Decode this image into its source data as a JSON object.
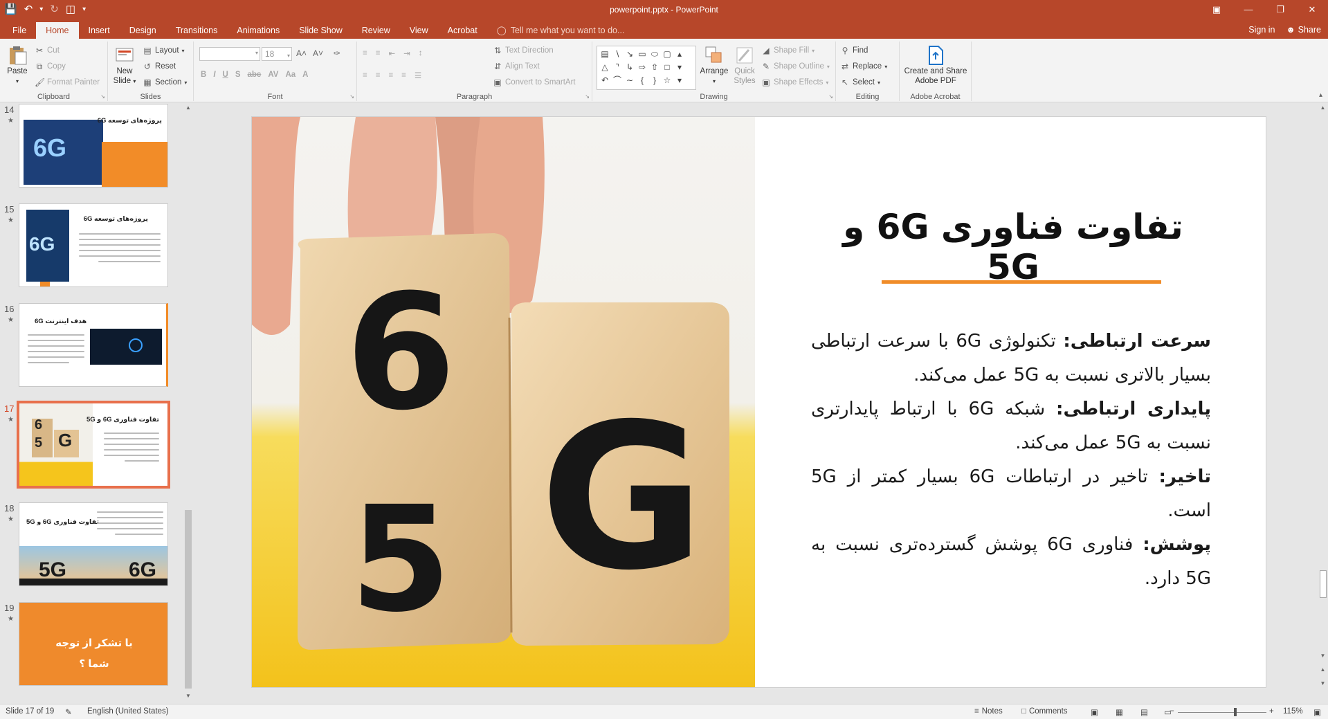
{
  "window": {
    "title": "powerpoint.pptx - PowerPoint",
    "accent": "#b7472a"
  },
  "qat": {
    "save_icon": "save-icon",
    "undo_icon": "undo-icon",
    "redo_icon": "redo-icon",
    "present_icon": "present-from-start-icon"
  },
  "tabs": [
    {
      "label": "File"
    },
    {
      "label": "Home"
    },
    {
      "label": "Insert"
    },
    {
      "label": "Design"
    },
    {
      "label": "Transitions"
    },
    {
      "label": "Animations"
    },
    {
      "label": "Slide Show"
    },
    {
      "label": "Review"
    },
    {
      "label": "View"
    },
    {
      "label": "Acrobat"
    }
  ],
  "tell_me": "Tell me what you want to do...",
  "account": {
    "sign_in": "Sign in",
    "share": "Share"
  },
  "ribbon": {
    "clipboard": {
      "paste": "Paste",
      "cut": "Cut",
      "copy": "Copy",
      "format_painter": "Format Painter",
      "label": "Clipboard"
    },
    "slides": {
      "new_slide_1": "New",
      "new_slide_2": "Slide",
      "layout": "Layout",
      "reset": "Reset",
      "section": "Section",
      "label": "Slides"
    },
    "font": {
      "font_name": "",
      "font_size": "18",
      "label": "Font"
    },
    "paragraph": {
      "text_direction": "Text Direction",
      "align_text": "Align Text",
      "smartart": "Convert to SmartArt",
      "label": "Paragraph"
    },
    "drawing": {
      "arrange": "Arrange",
      "quick_styles_1": "Quick",
      "quick_styles_2": "Styles",
      "shape_fill": "Shape Fill",
      "shape_outline": "Shape Outline",
      "shape_effects": "Shape Effects",
      "label": "Drawing"
    },
    "editing": {
      "find": "Find",
      "replace": "Replace",
      "select": "Select",
      "label": "Editing"
    },
    "acrobat": {
      "create_1": "Create and Share",
      "create_2": "Adobe PDF",
      "label": "Adobe Acrobat"
    }
  },
  "thumbnails": [
    {
      "num": "14",
      "title": "پروژه‌های توسعه 6G"
    },
    {
      "num": "15",
      "title": "پروژه‌های توسعه 6G"
    },
    {
      "num": "16",
      "title": "هدف اینترنت 6G"
    },
    {
      "num": "17",
      "title": "تفاوت فناوری 6G و 5G"
    },
    {
      "num": "18",
      "title": "تفاوت فناوری 6G و 5G"
    },
    {
      "num": "19",
      "title": "با تشکر از توجه شما ؟"
    }
  ],
  "slide": {
    "title": "تفاوت فناوری 6G و 5G",
    "paragraphs": [
      {
        "label": "سرعت ارتباطی:",
        "text": " تکنولوژی 6G با سرعت ارتباطی بسیار بالاتری نسبت به 5G عمل می‌کند."
      },
      {
        "label": "پایداری ارتباطی:",
        "text": " شبکه 6G با ارتباط پایدارتری نسبت به 5G عمل می‌کند."
      },
      {
        "label": "تاخیر:",
        "text": " تاخیر در ارتباطات 6G بسیار کمتر از 5G است."
      },
      {
        "label": "پوشش:",
        "text": " فناوری 6G پوشش گسترده‌تری نسبت به 5G دارد."
      }
    ],
    "image_cubes": {
      "top_left": "6",
      "bottom_left": "5",
      "right": "G"
    },
    "accent_line": "#f08c28"
  },
  "status": {
    "slide_of": "Slide 17 of 19",
    "language": "English (United States)",
    "notes": "Notes",
    "comments": "Comments",
    "zoom": "115%"
  }
}
